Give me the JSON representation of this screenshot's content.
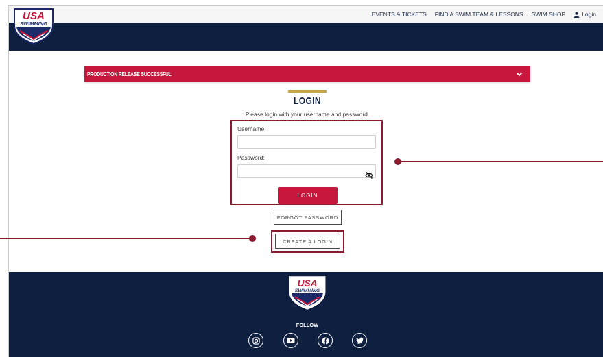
{
  "topnav": {
    "items": [
      "EVENTS & TICKETS",
      "FIND A SWIM TEAM & LESSONS",
      "SWIM SHOP"
    ],
    "login_label": "Login"
  },
  "logo": {
    "top_text": "USA",
    "bottom_text": "SWIMMING"
  },
  "banner": {
    "text": "PRODUCTION RELEASE SUCCESSFUL"
  },
  "login_form": {
    "title": "LOGIN",
    "subtitle": "Please login with your username and password.",
    "username_label": "Username:",
    "username_value": "",
    "password_label": "Password:",
    "password_value": "",
    "login_button": "LOGIN",
    "forgot_password_button": "FORGOT PASSWORD",
    "create_login_button": "CREATE A LOGIN"
  },
  "footer": {
    "follow_label": "FOLLOW",
    "social": [
      "instagram-icon",
      "youtube-icon",
      "facebook-icon",
      "twitter-icon"
    ]
  },
  "colors": {
    "navy": "#0e1f40",
    "brand_red": "#c8173c",
    "callout": "#8b1a2f",
    "gold_rule": "#c9a24a"
  }
}
